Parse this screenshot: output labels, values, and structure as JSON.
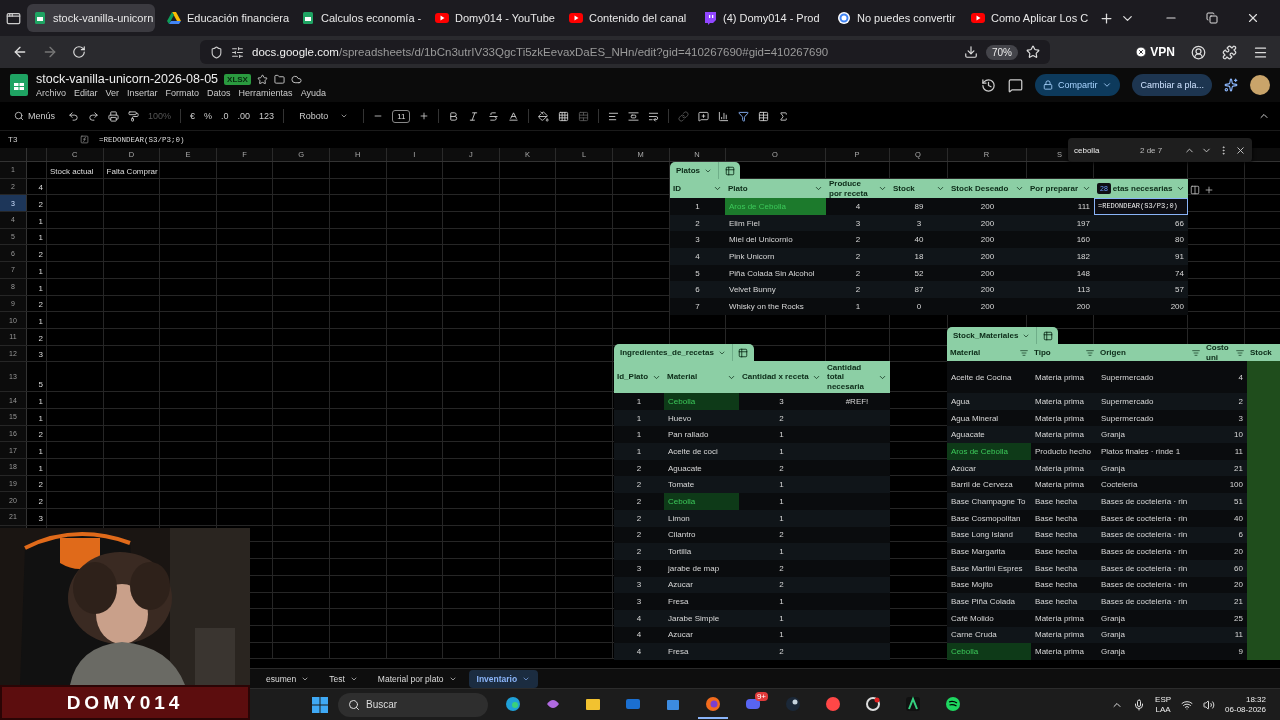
{
  "browser": {
    "tabs": [
      {
        "title": "stock-vanilla-unicorn",
        "selected": true
      },
      {
        "title": "Educación financiera",
        "selected": false
      },
      {
        "title": "Calculos economía -",
        "selected": false
      },
      {
        "title": "Domy014 - YouTube",
        "selected": false
      },
      {
        "title": "Contenido del canal",
        "selected": false
      },
      {
        "title": "(4) Domy014 - Prod",
        "selected": false
      },
      {
        "title": "No puedes convertir",
        "selected": false
      },
      {
        "title": "Como Aplicar Los C",
        "selected": false
      }
    ],
    "url_host": "docs.google.com",
    "url_path": "/spreadsheets/d/1bCn3utrIV33QgcTi5zkEevaxDaES_NHn/edit?gid=410267690#gid=410267690",
    "zoom": "70%",
    "vpn": "VPN"
  },
  "sheets": {
    "title": "stock-vanilla-unicorn-2026-08-05",
    "badge": "XLSX",
    "menu": [
      "Archivo",
      "Editar",
      "Ver",
      "Insertar",
      "Formato",
      "Datos",
      "Herramientas",
      "Ayuda"
    ],
    "share": "Compartir",
    "switch": "Cambiar a pla..."
  },
  "toolbar": {
    "menus": "Menús",
    "zoom": "100%",
    "currency": "€",
    "percent": "%",
    "decimals_less": ".0",
    "decimals_more": ".00",
    "number_format": "123",
    "font": "Roboto",
    "font_size": "11"
  },
  "formula_bar": {
    "cell": "T3",
    "formula": "=REDONDEAR(S3/P3;0)"
  },
  "find": {
    "query": "cebolla",
    "count": "2 de 7"
  },
  "sheet": {
    "columns": [
      "C",
      "D",
      "E",
      "F",
      "G",
      "H",
      "I",
      "J",
      "K",
      "L",
      "M",
      "N",
      "O",
      "P",
      "Q",
      "R",
      "S"
    ],
    "rows": [
      {
        "number": "1",
        "c": "Stock actual",
        "d": "Falta Comprar",
        "selected": false
      },
      {
        "number": "2",
        "b": "4",
        "selected": false
      },
      {
        "number": "3",
        "b": "2",
        "selected": true
      },
      {
        "number": "4",
        "b": "1",
        "selected": false
      },
      {
        "number": "5",
        "b": "1",
        "selected": false
      },
      {
        "number": "6",
        "b": "2",
        "selected": false
      },
      {
        "number": "7",
        "b": "1",
        "selected": false
      },
      {
        "number": "8",
        "b": "1",
        "selected": false
      },
      {
        "number": "9",
        "b": "2",
        "selected": false
      },
      {
        "number": "10",
        "b": "1",
        "selected": false
      },
      {
        "number": "11",
        "b": "2",
        "selected": false
      },
      {
        "number": "12",
        "b": "3",
        "selected": false
      },
      {
        "number": "13",
        "b": "5",
        "selected": false
      },
      {
        "number": "14",
        "b": "1",
        "selected": false
      },
      {
        "number": "15",
        "b": "1",
        "selected": false
      },
      {
        "number": "16",
        "b": "2",
        "selected": false
      },
      {
        "number": "17",
        "b": "1",
        "selected": false
      },
      {
        "number": "18",
        "b": "1",
        "selected": false
      },
      {
        "number": "19",
        "b": "2",
        "selected": false
      },
      {
        "number": "20",
        "b": "2",
        "selected": false
      },
      {
        "number": "21",
        "b": "3",
        "selected": false
      }
    ]
  },
  "platos": {
    "name": "Platos",
    "columns": [
      {
        "label": "ID"
      },
      {
        "label": "Plato"
      },
      {
        "label": "Produce por receta"
      },
      {
        "label": "Stock"
      },
      {
        "label": "Stock Deseado"
      },
      {
        "label": "Por preparar"
      },
      {
        "label": "etas necesarias",
        "chip": "28"
      }
    ],
    "rows": [
      {
        "cells": [
          "1",
          "Aros de Cebolla",
          "4",
          "89",
          "200",
          "111",
          "=REDONDEAR(S3/P3;0)"
        ],
        "match": true,
        "editing": true
      },
      {
        "cells": [
          "2",
          "Elim Fiel",
          "3",
          "3",
          "200",
          "197",
          "66"
        ],
        "match": false,
        "editing": false
      },
      {
        "cells": [
          "3",
          "Miel del Unicornio",
          "2",
          "40",
          "200",
          "160",
          "80"
        ],
        "match": false,
        "editing": false
      },
      {
        "cells": [
          "4",
          "Pink Unicorn",
          "2",
          "18",
          "200",
          "182",
          "91"
        ],
        "match": false,
        "editing": false
      },
      {
        "cells": [
          "5",
          "Piña Colada Sin Alcohol",
          "2",
          "52",
          "200",
          "148",
          "74"
        ],
        "match": false,
        "editing": false
      },
      {
        "cells": [
          "6",
          "Velvet Bunny",
          "2",
          "87",
          "200",
          "113",
          "57"
        ],
        "match": false,
        "editing": false
      },
      {
        "cells": [
          "7",
          "Whisky on the Rocks",
          "1",
          "0",
          "200",
          "200",
          "200"
        ],
        "match": false,
        "editing": false
      }
    ]
  },
  "ingredientes": {
    "name": "Ingredientes_de_recetas",
    "columns": [
      {
        "label": "Id_Plato"
      },
      {
        "label": "Material"
      },
      {
        "label": "Cantidad x receta"
      },
      {
        "label": "Cantidad total necesaria"
      }
    ],
    "rows": [
      {
        "cells": [
          "1",
          "Cebolla",
          "3",
          "#REF!"
        ],
        "match": true
      },
      {
        "cells": [
          "1",
          "Huevo",
          "2"
        ],
        "match": false
      },
      {
        "cells": [
          "1",
          "Pan rallado",
          "1"
        ],
        "match": false
      },
      {
        "cells": [
          "1",
          "Aceite de coci",
          "1"
        ],
        "match": false
      },
      {
        "cells": [
          "2",
          "Aguacate",
          "2"
        ],
        "match": false
      },
      {
        "cells": [
          "2",
          "Tomate",
          "1"
        ],
        "match": false
      },
      {
        "cells": [
          "2",
          "Cebolla",
          "1"
        ],
        "match": true
      },
      {
        "cells": [
          "2",
          "Limon",
          "1"
        ],
        "match": false
      },
      {
        "cells": [
          "2",
          "Cilantro",
          "2"
        ],
        "match": false
      },
      {
        "cells": [
          "2",
          "Tortilla",
          "1"
        ],
        "match": false
      },
      {
        "cells": [
          "3",
          "jarabe de map",
          "2"
        ],
        "match": false
      },
      {
        "cells": [
          "3",
          "Azucar",
          "2"
        ],
        "match": false
      },
      {
        "cells": [
          "3",
          "Fresa",
          "1"
        ],
        "match": false
      },
      {
        "cells": [
          "4",
          "Jarabe Simple",
          "1"
        ],
        "match": false
      },
      {
        "cells": [
          "4",
          "Azucar",
          "1"
        ],
        "match": false
      },
      {
        "cells": [
          "4",
          "Fresa",
          "2"
        ],
        "match": false
      }
    ]
  },
  "stock_materiales": {
    "name": "Stock_Materiales",
    "columns": [
      {
        "label": "Material"
      },
      {
        "label": "Tipo"
      },
      {
        "label": "Origen"
      },
      {
        "label": "Costo uni"
      },
      {
        "label": "Stock"
      }
    ],
    "rows": [
      {
        "cells": [
          "Aceite de Cocina",
          "Materia prima",
          "Supermercado",
          "4"
        ],
        "match": false
      },
      {
        "cells": [
          "Agua",
          "Materia prima",
          "Supermercado",
          "2"
        ],
        "match": false
      },
      {
        "cells": [
          "Agua Mineral",
          "Materia prima",
          "Supermercado",
          "3"
        ],
        "match": false
      },
      {
        "cells": [
          "Aguacate",
          "Materia prima",
          "Granja",
          "10"
        ],
        "match": false
      },
      {
        "cells": [
          "Aros de Cebolla",
          "Producto hecho",
          "Platos finales · rinde 1",
          "11"
        ],
        "match": true
      },
      {
        "cells": [
          "Azúcar",
          "Materia prima",
          "Granja",
          "21"
        ],
        "match": false
      },
      {
        "cells": [
          "Barril de Cerveza",
          "Materia prima",
          "Coctelería",
          "100"
        ],
        "match": false
      },
      {
        "cells": [
          "Base Champagne To",
          "Base hecha",
          "Bases de coctelería · rin",
          "51"
        ],
        "match": false
      },
      {
        "cells": [
          "Base Cosmopolitan",
          "Base hecha",
          "Bases de coctelería · rin",
          "40"
        ],
        "match": false
      },
      {
        "cells": [
          "Base Long Island",
          "Base hecha",
          "Bases de coctelería · rin",
          "6"
        ],
        "match": false
      },
      {
        "cells": [
          "Base Margarita",
          "Base hecha",
          "Bases de coctelería · rin",
          "20"
        ],
        "match": false
      },
      {
        "cells": [
          "Base Martini Espres",
          "Base hecha",
          "Bases de coctelería · rin",
          "60"
        ],
        "match": false
      },
      {
        "cells": [
          "Base Mojito",
          "Base hecha",
          "Bases de coctelería · rin",
          "20"
        ],
        "match": false
      },
      {
        "cells": [
          "Base Piña Colada",
          "Base hecha",
          "Bases de coctelería · rin",
          "21"
        ],
        "match": false
      },
      {
        "cells": [
          "Café Molido",
          "Materia prima",
          "Granja",
          "25"
        ],
        "match": false
      },
      {
        "cells": [
          "Carne Cruda",
          "Materia prima",
          "Granja",
          "11"
        ],
        "match": false
      },
      {
        "cells": [
          "Cebolla",
          "Materia prima",
          "Granja",
          "9"
        ],
        "match": true
      }
    ]
  },
  "sheet_tabs": [
    {
      "label": "esumen",
      "selected": false
    },
    {
      "label": "Test",
      "selected": false
    },
    {
      "label": "Material por plato",
      "selected": false
    },
    {
      "label": "Inventario",
      "selected": true
    }
  ],
  "webcam": {
    "kind": "picture",
    "banner": "DOMY014"
  },
  "taskbar": {
    "search": "Buscar",
    "badge": "9+",
    "language": "ESP",
    "layout": "LAA",
    "time": "18:32",
    "date": "06-08-2026"
  }
}
